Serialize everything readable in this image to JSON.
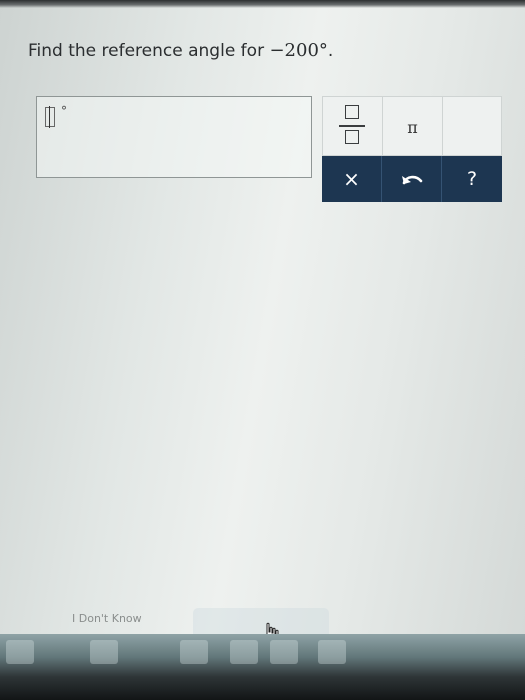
{
  "question": {
    "prompt": "Find the reference angle for ",
    "value": "−200°",
    "end": "."
  },
  "answer": {
    "unit_mark": "°"
  },
  "keypad": {
    "pi_label": "π",
    "clear_label": "×",
    "help_label": "?"
  },
  "footer": {
    "dont_know_label": "I Don't Know"
  },
  "colors": {
    "keypad_dark": "#1d3651",
    "keypad_light": "#eef1f0"
  }
}
